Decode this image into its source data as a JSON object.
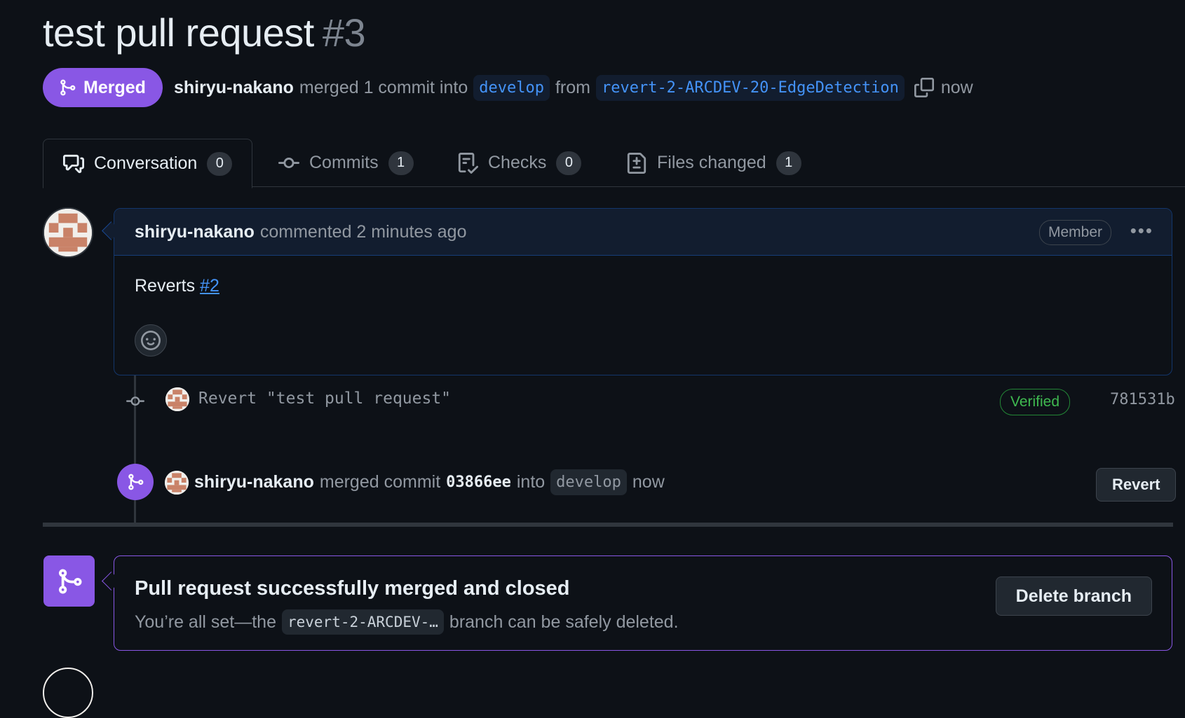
{
  "pr": {
    "title": "test pull request",
    "number": "#3",
    "state_label": "Merged",
    "author": "shiryu-nakano",
    "merge_text": "merged 1 commit into",
    "base_branch": "develop",
    "from_text": "from",
    "head_branch": "revert-2-ARCDEV-20-EdgeDetection",
    "time": "now"
  },
  "tabs": [
    {
      "label": "Conversation",
      "count": "0",
      "icon": "comment-discussion-icon"
    },
    {
      "label": "Commits",
      "count": "1",
      "icon": "git-commit-icon"
    },
    {
      "label": "Checks",
      "count": "0",
      "icon": "checklist-icon"
    },
    {
      "label": "Files changed",
      "count": "1",
      "icon": "file-diff-icon"
    }
  ],
  "comment": {
    "author": "shiryu-nakano",
    "action": "commented 2 minutes ago",
    "role_badge": "Member",
    "body_text": "Reverts",
    "body_link": "#2"
  },
  "commit": {
    "message": "Revert \"test pull request\"",
    "verified_label": "Verified",
    "sha": "781531b"
  },
  "merge_event": {
    "author": "shiryu-nakano",
    "text": "merged commit",
    "sha": "03866ee",
    "into_text": "into",
    "branch": "develop",
    "time": "now",
    "revert_label": "Revert"
  },
  "merge_box": {
    "title": "Pull request successfully merged and closed",
    "sub_prefix": "You’re all set—the",
    "branch": "revert-2-ARCDEV-…",
    "sub_suffix": "branch can be safely deleted.",
    "delete_label": "Delete branch"
  },
  "colors": {
    "background": "#0d1117",
    "merged_purple": "#8957e5",
    "link_blue": "#4493f8",
    "verified_green": "#3fb950"
  }
}
